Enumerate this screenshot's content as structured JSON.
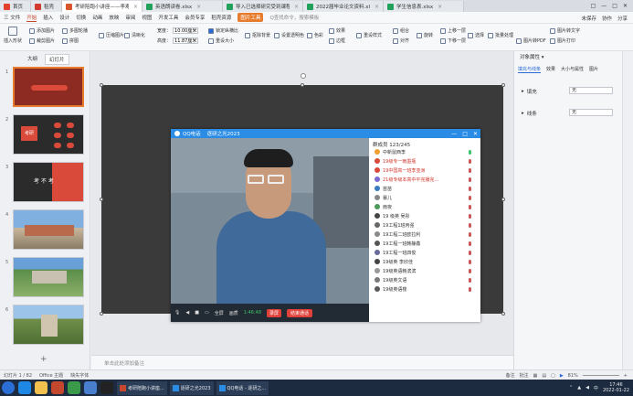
{
  "tabs": [
    {
      "label": "首页",
      "color": "#e2412d",
      "active": false
    },
    {
      "label": "稻壳",
      "color": "#d23a2f",
      "active": false
    },
    {
      "label": "考研陪跑小讲座——李寿.ppt",
      "color": "#d9552c",
      "active": true
    },
    {
      "label": "英语朗读卷.xlsx",
      "color": "#23a15a",
      "active": false
    },
    {
      "label": "导入已选择研究受到课程.xls",
      "color": "#23a15a",
      "active": false
    },
    {
      "label": "2022届毕业论文资料.xls",
      "color": "#23a15a",
      "active": false
    },
    {
      "label": "学生信息表.xlsx",
      "color": "#23a15a",
      "active": false
    }
  ],
  "window_controls": [
    "□",
    "—",
    "□",
    "✕"
  ],
  "menu": {
    "file_label": "三 文件",
    "items": [
      "开始",
      "插入",
      "设计",
      "切换",
      "动画",
      "放映",
      "审阅",
      "视图",
      "开发工具",
      "会员专享",
      "稻壳资源"
    ],
    "active": "开始",
    "play_button": "图片工具",
    "search_placeholder": "Q查找命令，搜索模板",
    "right_items": [
      "未保存",
      "协作",
      "分享"
    ]
  },
  "ribbon": {
    "group1": [
      "插入形状",
      "添加图片",
      "裁剪图片"
    ],
    "group2": [
      "多图轮播",
      "拼图",
      "图片拼接"
    ],
    "group3": [
      "压缩图片",
      "清晰化"
    ],
    "width_label": "宽度：",
    "width_value": "10.00厘米",
    "height_label": "高度：",
    "height_value": "11.87厘米",
    "lock_ratio": "锁定纵横比",
    "reset_size": "重设大小",
    "group4": [
      "抠除背景",
      "设置透明色",
      "色彩"
    ],
    "group5": [
      "效果",
      "边框",
      "重设样式"
    ],
    "group6": [
      "组合",
      "对齐",
      "旋转"
    ],
    "group7": [
      "上移一层",
      "下移一层",
      "选择"
    ],
    "group8": [
      "批量处理",
      "图片转PDF",
      "图片转文字",
      "图片打印"
    ]
  },
  "left_panel": {
    "tabs": [
      "大纲",
      "幻灯片"
    ],
    "active_tab": "幻灯片",
    "slide_numbers": [
      "1",
      "2",
      "3",
      "4",
      "5",
      "6"
    ],
    "slide3_text": "考  不  考",
    "slide2_text": "考研"
  },
  "qq_window": {
    "title": "QQ电话",
    "call_name": "逐研之光2023",
    "members_header": "群成员 123/245",
    "members": [
      "中新鼠西李",
      "19级专一雨墨瓶",
      "19中国高一班李亚洲",
      "21级专级本高中平完播完...",
      "苗苗",
      "暴儿",
      "雨夜",
      "19 级英 吴彤",
      "19工程1班丙强",
      "19工程二班欧拉利",
      "19工程一班韩静鑫",
      "19工程一班四俊",
      "19级英 李欣佳",
      "19级英语韩滨滨",
      "19级英文语",
      "19级英语楼"
    ],
    "controls": [
      "全屏",
      "画质",
      "1:46:48",
      "录屏",
      "结束通话"
    ],
    "timer": "1:46:48"
  },
  "right_panel": {
    "title": "对象属性 ▾",
    "tabs": [
      "填充与线条",
      "效果",
      "大小与属性",
      "图片"
    ],
    "fill_label": "填充",
    "fill_value": "无",
    "line_label": "线条",
    "line_value": "无"
  },
  "notes_placeholder": "单击此处添加备注",
  "status": {
    "slide_info": "幻灯片 1 / 82",
    "theme": "Office 主题",
    "missing_font": "缺失字体",
    "notes_btn": "备注",
    "comment_btn": "批注",
    "zoom": "81%"
  },
  "taskbar": {
    "tasks": [
      "考研陪跑小讲座...",
      "逐研之光2023",
      "QQ电话 - 逐研之..."
    ],
    "time": "17:46",
    "date": "2022-01-22",
    "lang": "中"
  }
}
